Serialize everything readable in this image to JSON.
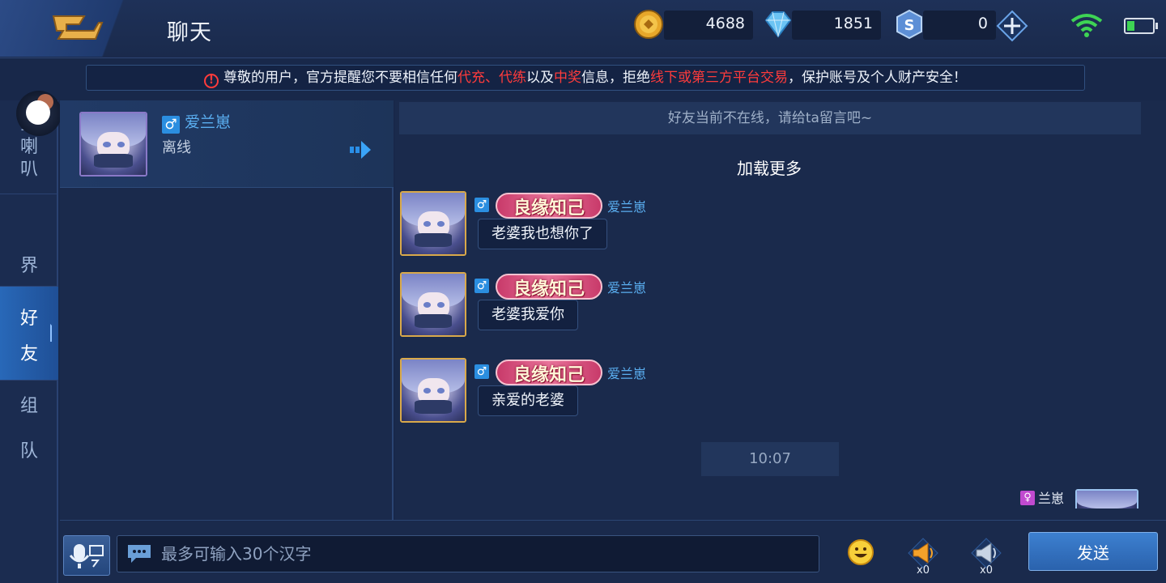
{
  "header": {
    "title": "聊天",
    "gold": "4688",
    "diamonds": "1851",
    "points": "0"
  },
  "warning": {
    "part1": "尊敬的用户，官方提醒您不要相信任何",
    "red1": "代充、代练",
    "part2": "以及",
    "red2": "中奖",
    "part3": "信息，拒绝",
    "red3": "线下或第三方平台交易",
    "part4": "，保护账号及个人财产安全！"
  },
  "leftnav": {
    "tabs": [
      {
        "chars": [
          "金",
          "喇",
          "叭"
        ]
      },
      {
        "chars": [
          "界"
        ]
      },
      {
        "chars": [
          "好",
          "友"
        ]
      },
      {
        "chars": [
          "组",
          "队"
        ]
      }
    ]
  },
  "friend": {
    "name": "爱兰崽",
    "status": "离线"
  },
  "chat": {
    "offline_banner": "好友当前不在线，请给ta留言吧~",
    "load_more": "加载更多",
    "badge": "良缘知己",
    "messages": [
      {
        "sender": "爱兰崽",
        "text": "老婆我也想你了"
      },
      {
        "sender": "爱兰崽",
        "text": "老婆我爱你"
      },
      {
        "sender": "爱兰崽",
        "text": "亲爱的老婆"
      }
    ],
    "timestamp": "10:07",
    "self_name": "兰崽"
  },
  "input": {
    "placeholder": "最多可输入30个汉字",
    "horn_large_count": "x0",
    "horn_small_count": "x0",
    "send_label": "发送"
  },
  "colors": {
    "accent": "#2b8ee0",
    "warning_red": "#ff3b3b",
    "background": "#1a2a4c"
  }
}
